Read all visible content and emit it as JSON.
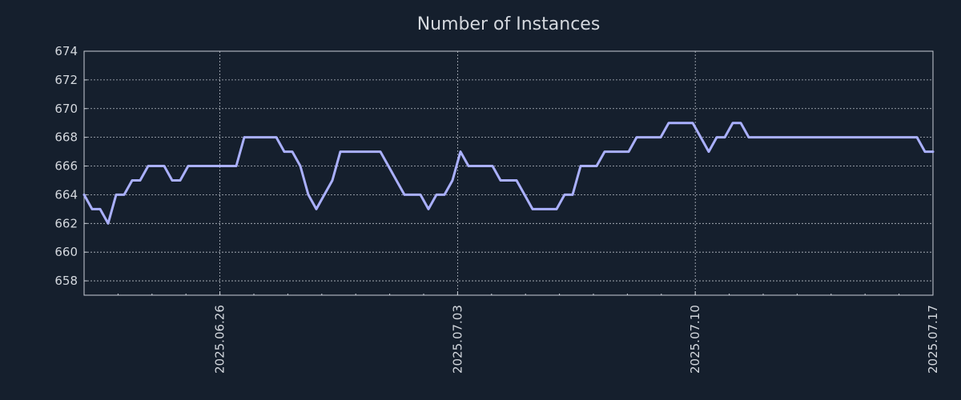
{
  "chart_data": {
    "type": "line",
    "title": "Number of Instances",
    "xlabel": "",
    "ylabel": "",
    "x_start": "2025.06.22",
    "x_end": "2025.07.17",
    "xlim": [
      "2025.06.22",
      "2025.07.17"
    ],
    "ylim": [
      657,
      674
    ],
    "y_ticks": [
      658,
      660,
      662,
      664,
      666,
      668,
      670,
      672,
      674
    ],
    "x_ticks": [
      "2025.06.26",
      "2025.07.03",
      "2025.07.10",
      "2025.07.17"
    ],
    "grid": true,
    "colors": {
      "background": "#151f2d",
      "line": "#aab0ff",
      "text": "#d4d8de",
      "grid": "#c9ced6"
    },
    "series": [
      {
        "values": [
          664,
          663,
          663,
          662,
          664,
          664,
          665,
          665,
          666,
          666,
          666,
          665,
          665,
          666,
          666,
          666,
          666,
          666,
          666,
          666,
          668,
          668,
          668,
          668,
          668,
          667,
          667,
          666,
          664,
          663,
          664,
          665,
          667,
          667,
          667,
          667,
          667,
          667,
          666,
          665,
          664,
          664,
          664,
          663,
          664,
          664,
          665,
          667,
          666,
          666,
          666,
          666,
          665,
          665,
          665,
          664,
          663,
          663,
          663,
          663,
          664,
          664,
          666,
          666,
          666,
          667,
          667,
          667,
          667,
          668,
          668,
          668,
          668,
          669,
          669,
          669,
          669,
          668,
          667,
          668,
          668,
          669,
          669,
          668,
          668,
          668,
          668,
          668,
          668,
          668,
          668,
          668,
          668,
          668,
          668,
          668,
          668,
          668,
          668,
          668,
          668,
          668,
          668,
          668,
          668,
          667,
          667
        ]
      }
    ]
  }
}
